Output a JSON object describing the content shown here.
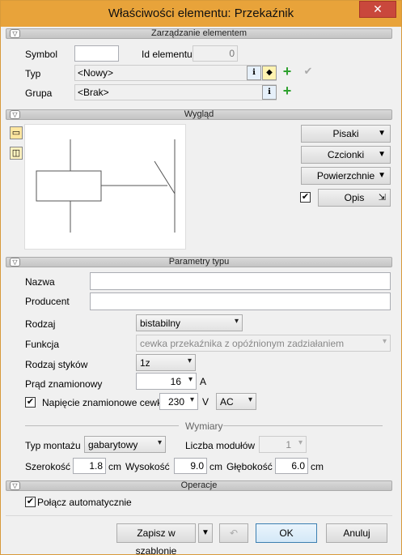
{
  "window": {
    "title": "Właściwości elementu: Przekaźnik",
    "close": "✕"
  },
  "sections": {
    "management": "Zarządzanie elementem",
    "appearance": "Wygląd",
    "type_params": "Parametry typu",
    "operations": "Operacje"
  },
  "management": {
    "symbol_label": "Symbol",
    "symbol_value": "",
    "id_label": "Id elementu",
    "id_value": "0",
    "type_label": "Typ",
    "type_value": "<Nowy>",
    "group_label": "Grupa",
    "group_value": "<Brak>"
  },
  "appearance": {
    "pens": "Pisaki",
    "fonts": "Czcionki",
    "surfaces": "Powierzchnie",
    "description": "Opis",
    "description_checked": true
  },
  "type_params": {
    "name_label": "Nazwa",
    "name_value": "",
    "producer_label": "Producent",
    "producer_value": "",
    "kind_label": "Rodzaj",
    "kind_value": "bistabilny",
    "function_label": "Funkcja",
    "function_value": "cewka przekaźnika z opóźnionym zadziałaniem",
    "contacts_label": "Rodzaj styków",
    "contacts_value": "1z",
    "current_label": "Prąd znamionowy",
    "current_value": "16",
    "current_unit": "A",
    "voltage_label": "Napięcie znamionowe cewki",
    "voltage_checked": true,
    "voltage_value": "230",
    "voltage_unit": "V",
    "voltage_kind": "AC"
  },
  "dimensions": {
    "title": "Wymiary",
    "mount_label": "Typ montażu",
    "mount_value": "gabarytowy",
    "modules_label": "Liczba modułów",
    "modules_value": "1",
    "width_label": "Szerokość",
    "width_value": "1.8",
    "height_label": "Wysokość",
    "height_value": "9.0",
    "depth_label": "Głębokość",
    "depth_value": "6.0",
    "unit": "cm"
  },
  "operations": {
    "auto_connect_label": "Połącz automatycznie",
    "auto_connect_checked": true
  },
  "footer": {
    "save_template": "Zapisz w szablonie",
    "ok": "OK",
    "cancel": "Anuluj"
  }
}
